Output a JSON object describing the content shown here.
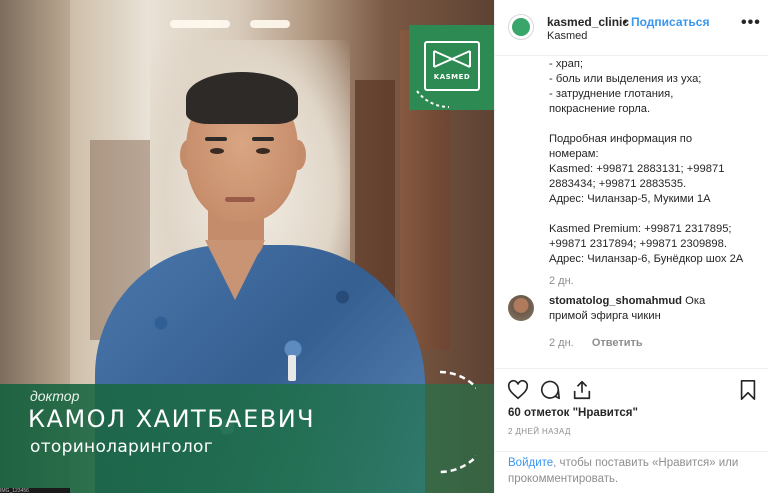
{
  "photo": {
    "caption": {
      "role": "доктор",
      "name": "КАМОЛ ХАИТБАЕВИЧ",
      "specialty": "оториноларинголог"
    },
    "logo_text": "KASMED",
    "image_id": "IMG_123456"
  },
  "header": {
    "username": "kasmed_clinic",
    "separator": "•",
    "follow_label": "Подписаться",
    "location": "Kasmed",
    "more_label": "•••"
  },
  "comments": {
    "caption_lines": [
      "- храп;",
      "- боль или выделения из уха;",
      "- затруднение глотания,",
      "покраснение горла.",
      "",
      "Подробная информация по",
      "номерам:",
      "Kasmed: +99871 2883131; +99871",
      "2883434; +99871 2883535.",
      "Адрес: Чиланзар-5, Мукими 1А",
      "",
      "Kasmed Premium: +99871 2317895;",
      "+99871 2317894; +99871 2309898.",
      "Адрес: Чиланзар-6, Бунёдкор шох 2А"
    ],
    "caption_time": "2 дн.",
    "reply": {
      "username": "stomatolog_shomahmud",
      "text_line1": "Ока",
      "text_line2": "примой эфирга чикин",
      "time": "2 дн.",
      "reply_label": "Ответить"
    }
  },
  "actions": {
    "likes": "60 отметок \"Нравится\"",
    "date": "2 ДНЕЙ НАЗАД",
    "login_link": "Войдите",
    "login_rest": ", чтобы поставить «Нравится» или",
    "login_line2": "прокомментировать."
  },
  "colors": {
    "brand_green": "#2c8a52",
    "link_blue": "#3897f0",
    "muted": "#8e8e8e"
  }
}
